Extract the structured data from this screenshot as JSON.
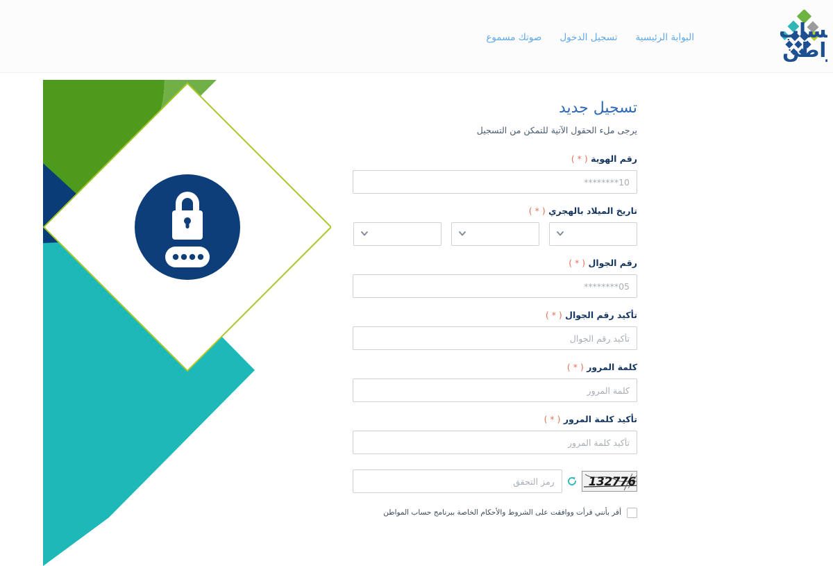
{
  "header": {
    "logo": {
      "name": "hesab-almowaten-logo",
      "line1": "حساب",
      "line2": "المواطن",
      "diamond_colors": [
        "#6cb33f",
        "#2fb7b7",
        "#9b9b9b",
        "#0a3c78",
        "#b5cc2f",
        "#1d4f91"
      ]
    },
    "nav": [
      {
        "label": "البوابة الرئيسية",
        "name": "nav-link-home"
      },
      {
        "label": "تسجيل الدخول",
        "name": "nav-link-login"
      },
      {
        "label": "صوتك مسموع",
        "name": "nav-link-voice"
      }
    ],
    "nav_color": "#5fa8e8"
  },
  "artwork": {
    "name": "password-lock-illustration",
    "colors": {
      "dark_green": "#4e9a1d",
      "light_green": "#70b046",
      "navy": "#0a3c78",
      "teal": "#1fb8b8",
      "lime_outline": "#a8c828",
      "circle_navy": "#0d3e7a",
      "icon_white": "#ffffff"
    },
    "icon": "padlock-with-dots-icon"
  },
  "form": {
    "title": "تسجيل جديد",
    "title_color": "#2f6bb5",
    "subtitle": "يرجى ملء الحقول الآتية للتمكن من التسجيل",
    "required_marker": "( * )",
    "fields": [
      {
        "name": "national-id",
        "label": "رقم الهوية",
        "placeholder": "10********",
        "value": "",
        "type": "text"
      },
      {
        "name": "hijri-birth-date",
        "label": "تاريخ الميلاد بالهجري",
        "type": "date-selects",
        "selects": [
          {
            "name": "birth-year-select",
            "value": "",
            "placeholder": ""
          },
          {
            "name": "birth-month-select",
            "value": "",
            "placeholder": ""
          },
          {
            "name": "birth-day-select",
            "value": "",
            "placeholder": ""
          }
        ]
      },
      {
        "name": "mobile-number",
        "label": "رقم الجوال",
        "placeholder": "05********",
        "value": "",
        "type": "text"
      },
      {
        "name": "confirm-mobile-number",
        "label": "تأكيد رقم الجوال",
        "placeholder": "تأكيد رقم الجوال",
        "value": "",
        "type": "text"
      },
      {
        "name": "password",
        "label": "كلمة المرور",
        "placeholder": "كلمة المرور",
        "value": "",
        "type": "password"
      },
      {
        "name": "confirm-password",
        "label": "تأكيد كلمة المرور",
        "placeholder": "تأكيد كلمة المرور",
        "value": "",
        "type": "password"
      }
    ],
    "captcha": {
      "name": "captcha",
      "code": "132776",
      "placeholder": "رمز التحقق",
      "value": "",
      "refresh_icon": "refresh-icon",
      "refresh_color": "#2fb7b7"
    },
    "terms": {
      "checkbox_checked": false,
      "text": "أقر بأنني قرأت ووافقت على الشروط والأحكام الخاصة ببرنامج حساب المواطن",
      "link_label": "الشروط والأحكام"
    }
  },
  "colors": {
    "input_border": "#cdd1d6",
    "label": "#16365f",
    "placeholder": "#a8aeb6",
    "asterisk": "#e8705a",
    "page_background": "#ffffff",
    "header_background": "#fcfcfd"
  }
}
